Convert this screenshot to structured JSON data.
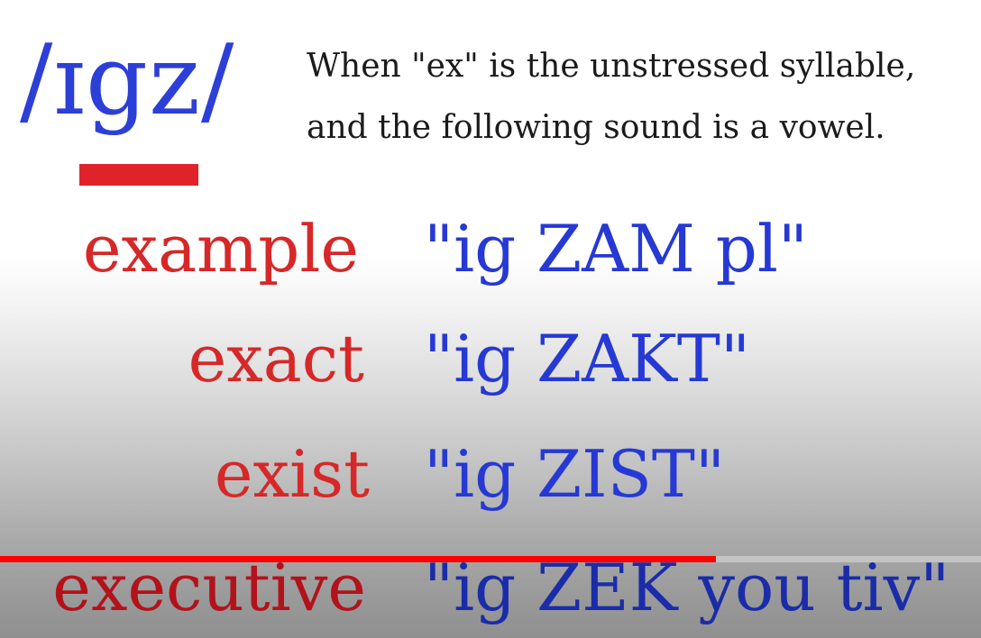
{
  "heading": {
    "ipa": "/ɪgz/",
    "rule_line1": "When \"ex\" is the unstressed syllable,",
    "rule_line2": "and the following sound is a vowel."
  },
  "examples": [
    {
      "word": "example",
      "pronunciation": "\"ig ZAM pl\""
    },
    {
      "word": "exact",
      "pronunciation": "\"ig ZAKT\""
    },
    {
      "word": "exist",
      "pronunciation": "\"ig ZIST\""
    },
    {
      "word": "executive",
      "pronunciation": "\"ig ZEK you tiv\""
    }
  ],
  "player": {
    "progress_fraction": 0.73
  },
  "colors": {
    "ipa_blue": "#2c3fd6",
    "word_red": "#d62828",
    "pron_blue": "#2639d4",
    "underline_red": "#e0232a",
    "progress_red": "#ff0000"
  }
}
